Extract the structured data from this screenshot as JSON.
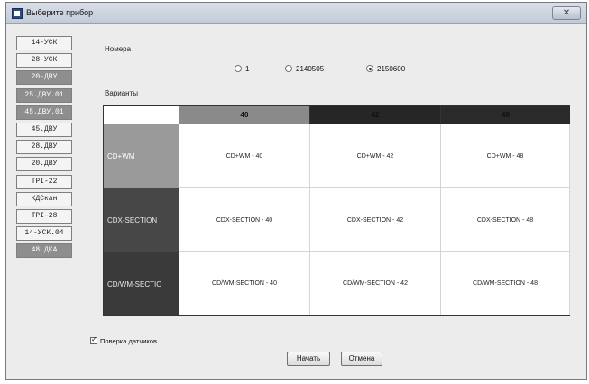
{
  "window": {
    "title": "Выберите прибор",
    "close_label": "✕"
  },
  "sidebar": {
    "items": [
      {
        "label": "14-УСК",
        "dark": false
      },
      {
        "label": "28-УСК",
        "dark": false
      },
      {
        "label": "20-ДВУ",
        "dark": true
      },
      {
        "label": "25.ДВУ.01",
        "dark": true
      },
      {
        "label": "45.ДВУ.01",
        "dark": true
      },
      {
        "label": "45.ДВУ",
        "dark": false
      },
      {
        "label": "28.ДВУ",
        "dark": false
      },
      {
        "label": "20.ДВУ",
        "dark": false
      },
      {
        "label": "ТРI-22",
        "dark": false
      },
      {
        "label": "КДСкан",
        "dark": false
      },
      {
        "label": "ТРI-28",
        "dark": false
      },
      {
        "label": "14-УСК.04",
        "dark": false
      },
      {
        "label": "48.ДКА",
        "dark": true
      }
    ]
  },
  "numbers": {
    "label": "Номера",
    "options": [
      {
        "label": "1",
        "selected": false
      },
      {
        "label": "2140505",
        "selected": false
      },
      {
        "label": "2150600",
        "selected": true
      }
    ]
  },
  "variants": {
    "label": "Варианты",
    "columns": [
      "40",
      "42",
      "48"
    ],
    "rows": [
      {
        "label": "CD+WM",
        "cells": [
          "CD+WM - 40",
          "CD+WM - 42",
          "CD+WM - 48"
        ]
      },
      {
        "label": "CDX-SECTION",
        "cells": [
          "CDX-SECTION - 40",
          "CDX-SECTION - 42",
          "CDX-SECTION - 48"
        ]
      },
      {
        "label": "CD/WM-SECTIO",
        "cells": [
          "CD/WM-SECTION - 40",
          "CD/WM-SECTION - 42",
          "CD/WM-SECTION - 48"
        ]
      }
    ]
  },
  "verify_checkbox": {
    "label": "Поверка датчиков",
    "checked": true
  },
  "buttons": {
    "start": "Начать",
    "cancel": "Отмена"
  }
}
